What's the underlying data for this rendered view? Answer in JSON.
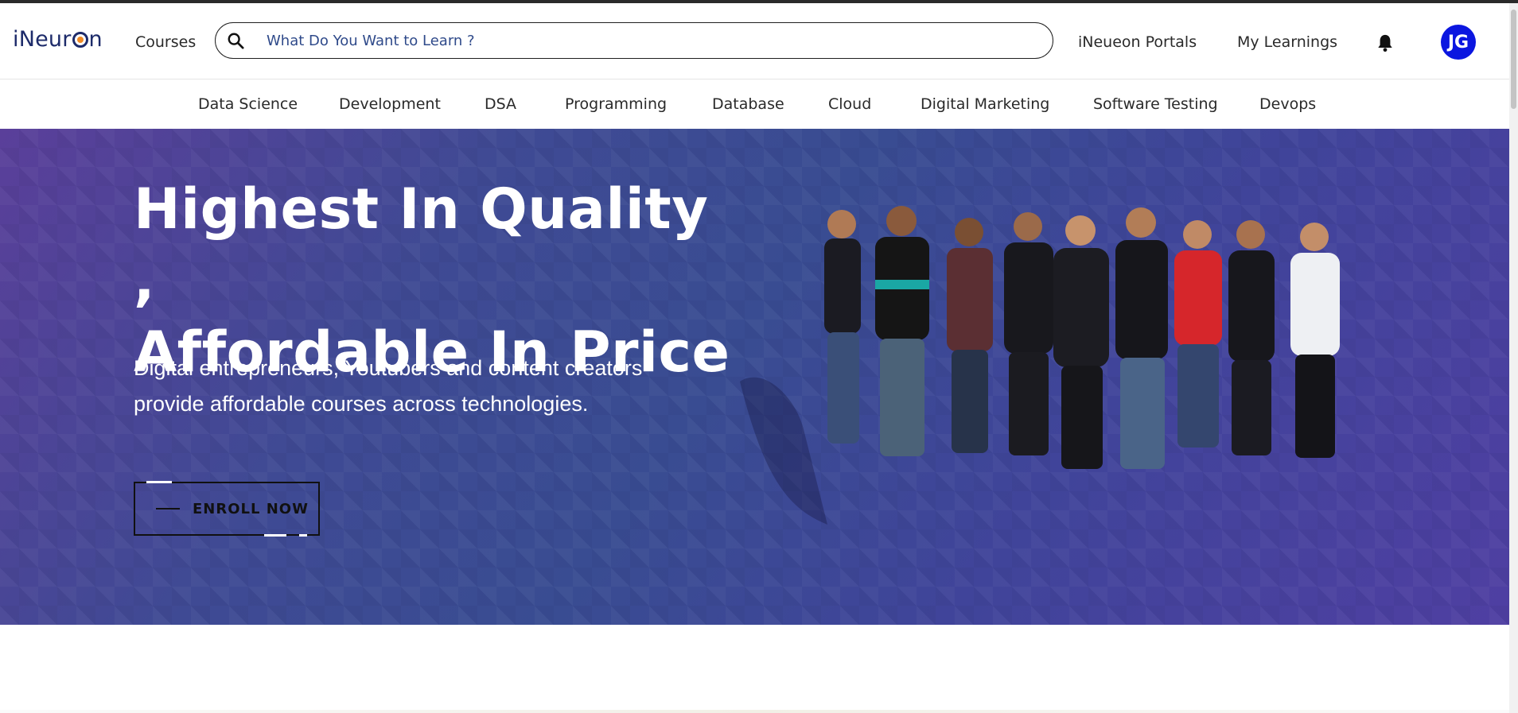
{
  "header": {
    "logo_text_left": "iNeur",
    "logo_text_right": "n",
    "courses_label": "Courses",
    "search_placeholder": "What Do You Want to Learn ?",
    "portals_label": "iNeueon Portals",
    "learnings_label": "My Learnings",
    "avatar_initials": "JG"
  },
  "categories": [
    "Data Science",
    "Development",
    "DSA",
    "Programming",
    "Database",
    "Cloud",
    "Digital Marketing",
    "Software Testing",
    "Devops"
  ],
  "hero": {
    "headline_line1": "Highest In Quality ,",
    "headline_line2": "Affordable In Price",
    "subtext": "Digital entrepreneurs, Youtubers and content creators provide affordable courses across technologies.",
    "cta_label": "ENROLL NOW"
  },
  "colors": {
    "brand_navy": "#1d2b6a",
    "logo_accent": "#f08a24",
    "avatar_blue": "#0b16e0",
    "hero_start": "#5a3f9a",
    "hero_mid": "#394c92",
    "hero_end": "#4f3fa2"
  },
  "icons": {
    "search": "search-icon",
    "bell": "bell-icon"
  }
}
